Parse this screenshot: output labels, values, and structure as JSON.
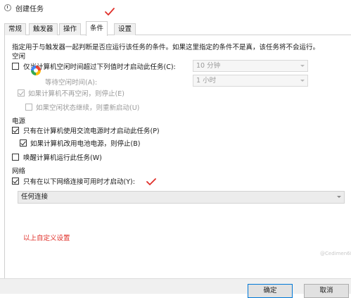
{
  "window": {
    "title": "创建任务",
    "title_icon": "clock-icon"
  },
  "tabs": [
    {
      "label": "常规",
      "active": false
    },
    {
      "label": "触发器",
      "active": false
    },
    {
      "label": "操作",
      "active": false
    },
    {
      "label": "条件",
      "active": true
    },
    {
      "label": "设置",
      "active": false
    }
  ],
  "description": "指定用于与触发器一起判断是否应运行该任务的条件。如果这里指定的条件不是真，该任务将不会运行。",
  "idle": {
    "header": "空闲",
    "start_only_if_idle": {
      "label": "仅当计算机空闲时间超过下列值时才启动此任务(C):",
      "checked": false
    },
    "idle_duration": {
      "value": "10 分钟"
    },
    "wait_for_idle": {
      "label": "等待空闲时间(A):",
      "value": "1 小时"
    },
    "stop_if_not_idle": {
      "label": "如果计算机不再空闲，则停止(E)",
      "checked": true,
      "enabled": false
    },
    "restart_if_idle_resumes": {
      "label": "如果空闲状态继续，则重新启动(U)",
      "checked": false,
      "enabled": false
    }
  },
  "power": {
    "header": "电源",
    "ac_power_only": {
      "label": "只有在计算机使用交流电源时才启动此任务(P)",
      "checked": true
    },
    "stop_on_battery": {
      "label": "如果计算机改用电池电源，则停止(B)",
      "checked": true
    },
    "wake_to_run": {
      "label": "唤醒计算机运行此任务(W)",
      "checked": false
    }
  },
  "network": {
    "header": "网络",
    "network_only": {
      "label": "只有在以下网络连接可用时才启动(Y):",
      "checked": true
    },
    "connection": {
      "value": "任何连接"
    }
  },
  "annotation": {
    "text": "以上自定义设置",
    "color": "#e0302a"
  },
  "buttons": {
    "ok": "确定",
    "cancel": "取消"
  },
  "watermark": "@Cedimen68",
  "colors": {
    "annotation_red": "#e0302a",
    "focus_blue": "#0078d7"
  }
}
